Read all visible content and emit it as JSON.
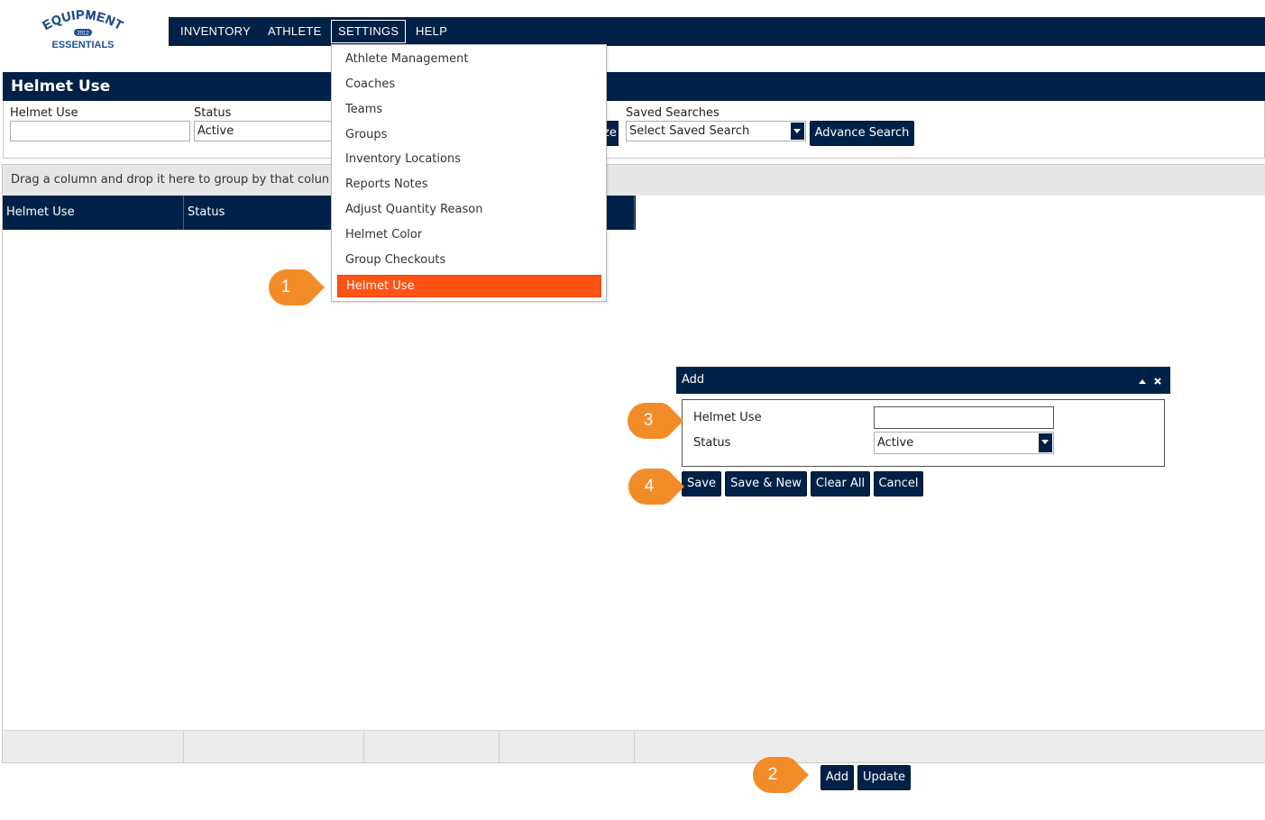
{
  "logo": {
    "line1": "EQUIPMENT",
    "year": "2012",
    "line2": "ESSENTIALS"
  },
  "nav": {
    "items": [
      {
        "label": "INVENTORY",
        "active": false
      },
      {
        "label": "ATHLETE",
        "active": false
      },
      {
        "label": "SETTINGS",
        "active": true
      },
      {
        "label": "HELP",
        "active": false
      }
    ]
  },
  "settings_menu": {
    "items": [
      {
        "label": "Athlete Management",
        "selected": false
      },
      {
        "label": "Coaches",
        "selected": false
      },
      {
        "label": "Teams",
        "selected": false
      },
      {
        "label": "Groups",
        "selected": false
      },
      {
        "label": "Inventory Locations",
        "selected": false
      },
      {
        "label": "Reports Notes",
        "selected": false
      },
      {
        "label": "Adjust Quantity Reason",
        "selected": false
      },
      {
        "label": "Helmet Color",
        "selected": false
      },
      {
        "label": "Group Checkouts",
        "selected": false
      },
      {
        "label": "Helmet Use",
        "selected": true
      }
    ]
  },
  "page": {
    "title": "Helmet Use"
  },
  "search": {
    "helmet_use_label": "Helmet Use",
    "helmet_use_value": "",
    "status_label": "Status",
    "status_value": "Active",
    "hidden_button_fragment": "ze",
    "saved_searches_label": "Saved Searches",
    "saved_searches_value": "Select Saved Search",
    "advance_search_label": "Advance Search"
  },
  "grid": {
    "group_hint": "Drag a column and drop it here to group by that colun",
    "columns": [
      "Helmet Use",
      "Status"
    ],
    "rows": []
  },
  "actions": {
    "add_label": "Add",
    "update_label": "Update"
  },
  "dialog": {
    "title": "Add",
    "helmet_use_label": "Helmet Use",
    "helmet_use_value": "",
    "status_label": "Status",
    "status_value": "Active",
    "save_label": "Save",
    "save_new_label": "Save & New",
    "clear_all_label": "Clear All",
    "cancel_label": "Cancel"
  },
  "callouts": [
    "1",
    "2",
    "3",
    "4"
  ],
  "colors": {
    "navy": "#002147",
    "highlight": "#fe5314",
    "callout": "#f28c28"
  },
  "icons": [
    "collapse-icon",
    "close-icon",
    "dropdown-arrow-icon"
  ]
}
